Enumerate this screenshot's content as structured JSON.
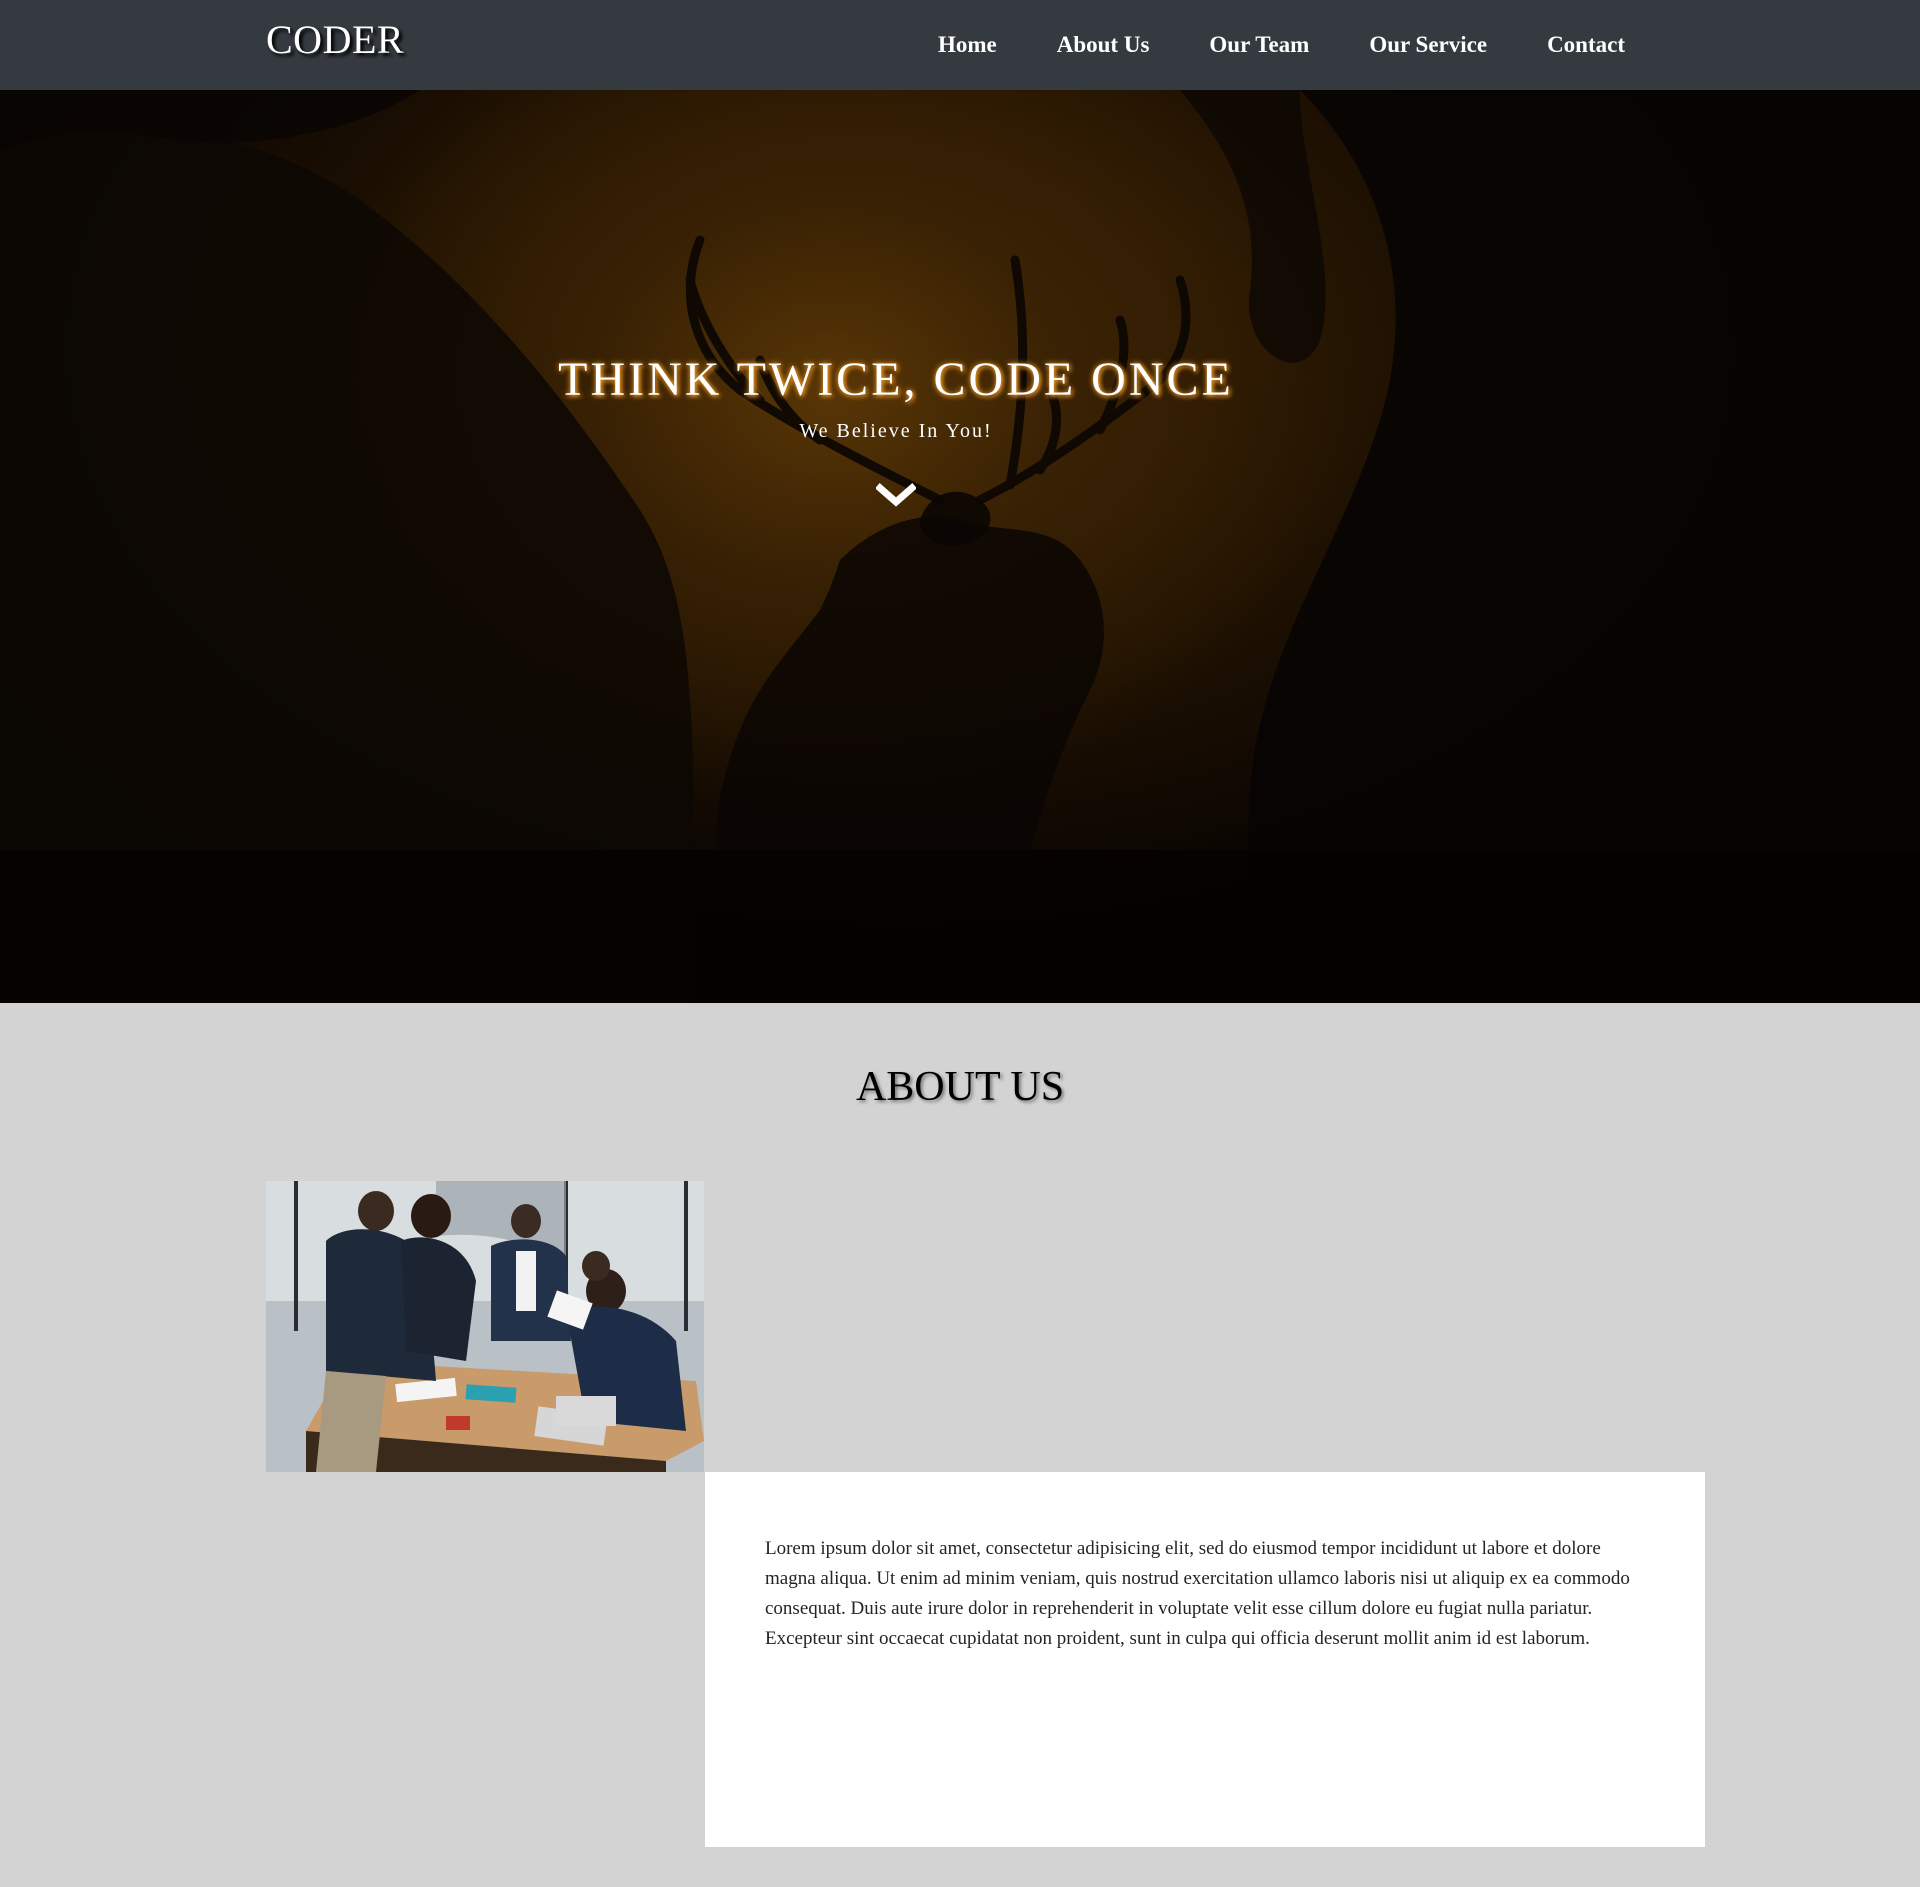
{
  "navbar": {
    "brand": "CODER",
    "links": [
      {
        "label": "Home"
      },
      {
        "label": "About Us"
      },
      {
        "label": "Our Team"
      },
      {
        "label": "Our Service"
      },
      {
        "label": "Contact"
      }
    ]
  },
  "hero": {
    "title": "THINK TWICE, CODE ONCE",
    "subtitle": "We Believe In You!",
    "scroll_icon": "chevron-down-icon"
  },
  "about": {
    "title": "ABOUT US",
    "image_alt": "team meeting around a table",
    "text": "Lorem ipsum dolor sit amet, consectetur adipisicing elit, sed do eiusmod tempor incididunt ut labore et dolore magna aliqua. Ut enim ad minim veniam, quis nostrud exercitation ullamco laboris nisi ut aliquip ex ea commodo consequat. Duis aute irure dolor in reprehenderit in voluptate velit esse cillum dolore eu fugiat nulla pariatur. Excepteur sint occaecat cupidatat non proident, sunt in culpa qui officia deserunt mollit anim id est laborum."
  },
  "colors": {
    "navbar_bg": "#343a40",
    "page_bg": "#d3d3d3",
    "card_bg": "#ffffff",
    "hero_glow": "#f0a030"
  }
}
